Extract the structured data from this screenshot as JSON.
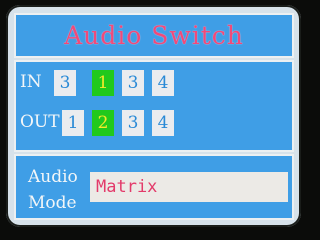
{
  "title": "Audio Switch",
  "in_row": {
    "label": "IN",
    "cells": [
      {
        "value": "3",
        "active": false
      },
      {
        "value": "1",
        "active": true
      },
      {
        "value": "3",
        "active": false
      },
      {
        "value": "4",
        "active": false
      }
    ]
  },
  "out_row": {
    "label": "OUT",
    "cells": [
      {
        "value": "1",
        "active": false
      },
      {
        "value": "2",
        "active": true
      },
      {
        "value": "3",
        "active": false
      },
      {
        "value": "4",
        "active": false
      }
    ]
  },
  "mode": {
    "label_line1": "Audio",
    "label_line2": "Mode",
    "value": "Matrix"
  },
  "colors": {
    "panel": "#3f9ee6",
    "title_text": "#f04a7a",
    "active_cell": "#21c91c",
    "active_text": "#f5e92a",
    "cell_text": "#2a8ad6",
    "mode_value_text": "#e33a6a"
  }
}
